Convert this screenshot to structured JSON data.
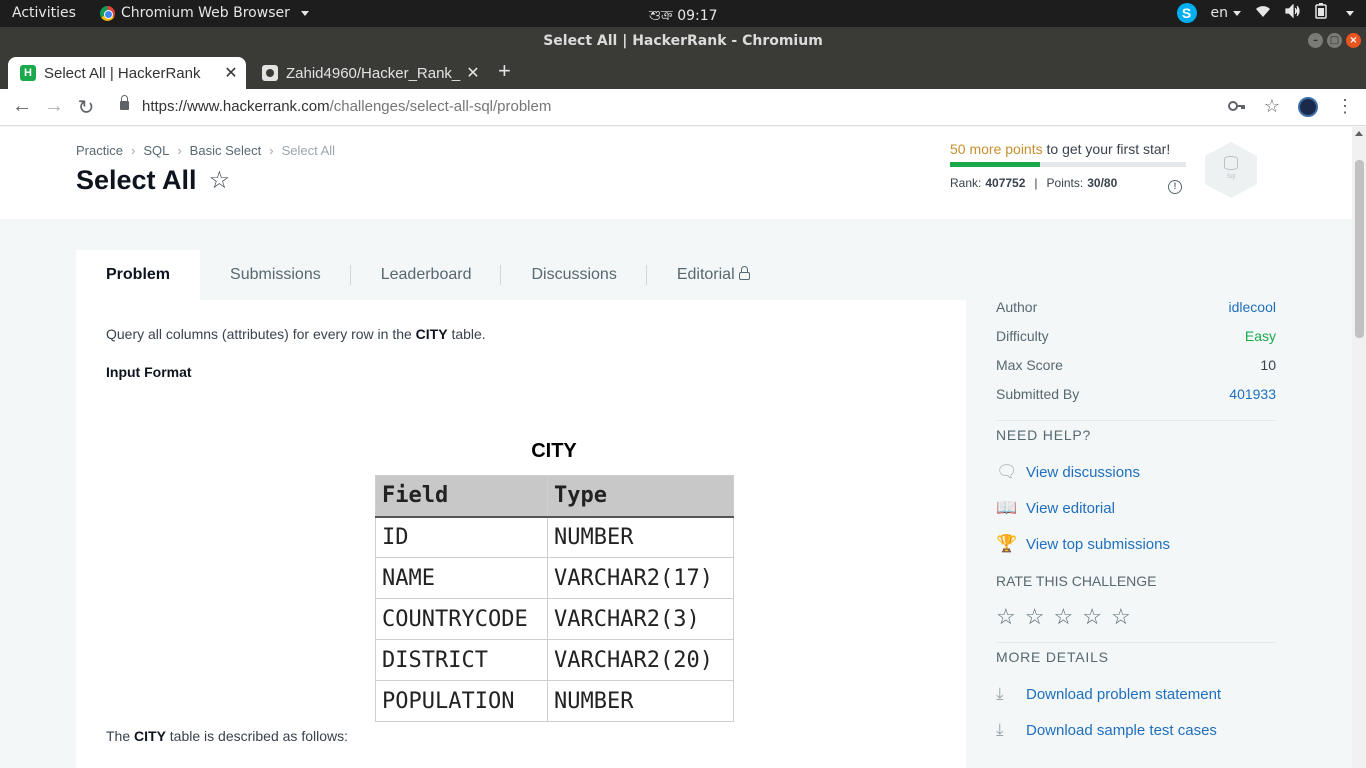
{
  "system": {
    "activities": "Activities",
    "app_name": "Chromium Web Browser",
    "clock": "শুক্র 09:17",
    "language": "en"
  },
  "window": {
    "title": "Select All | HackerRank - Chromium"
  },
  "tabs": [
    {
      "title": "Select All | HackerRank",
      "active": true
    },
    {
      "title": "Zahid4960/Hacker_Rank_",
      "active": false
    }
  ],
  "address": {
    "host": "https://www.hackerrank.com",
    "path": "/challenges/select-all-sql/problem"
  },
  "breadcrumb": [
    "Practice",
    "SQL",
    "Basic Select",
    "Select All"
  ],
  "page_title": "Select All",
  "progress": {
    "highlight": "50 more points",
    "text": "to get your first star!",
    "fraction": 0.38,
    "rank_label": "Rank:",
    "rank_value": "407752",
    "points_label": "Points:",
    "points_value": "30/80",
    "badge_label": "Sql"
  },
  "content_tabs": [
    "Problem",
    "Submissions",
    "Leaderboard",
    "Discussions",
    "Editorial"
  ],
  "problem": {
    "intro_pre": "Query all columns (attributes) for every row in the ",
    "intro_bold": "CITY",
    "intro_post": " table.",
    "input_format": "Input Format",
    "table_title": "CITY",
    "table_headers": [
      "Field",
      "Type"
    ],
    "table_rows": [
      [
        "ID",
        "NUMBER"
      ],
      [
        "NAME",
        "VARCHAR2(17)"
      ],
      [
        "COUNTRYCODE",
        "VARCHAR2(3)"
      ],
      [
        "DISTRICT",
        "VARCHAR2(20)"
      ],
      [
        "POPULATION",
        "NUMBER"
      ]
    ],
    "desc_pre": "The ",
    "desc_bold": "CITY",
    "desc_post": " table is described as follows:"
  },
  "sidebar": {
    "details": [
      {
        "label": "Author",
        "value": "idlecool"
      },
      {
        "label": "Difficulty",
        "value": "Easy"
      },
      {
        "label": "Max Score",
        "value": "10"
      },
      {
        "label": "Submitted By",
        "value": "401933"
      }
    ],
    "need_help": "NEED HELP?",
    "help_links": [
      "View discussions",
      "View editorial",
      "View top submissions"
    ],
    "rate": "RATE THIS CHALLENGE",
    "more_details": "MORE DETAILS",
    "downloads": [
      "Download problem statement",
      "Download sample test cases"
    ]
  },
  "colors": {
    "brand_green": "#1ba94c",
    "link_blue": "#1f6fbf",
    "points_orange": "#c98e2d"
  }
}
